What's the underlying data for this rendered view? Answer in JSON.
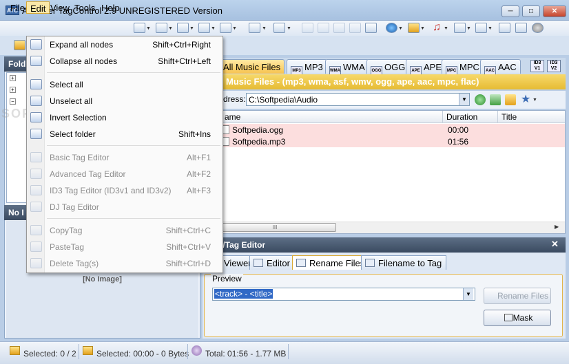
{
  "window": {
    "title": "Abander TagControl 2.9 UNREGISTERED Version",
    "icon_text": "ATC",
    "buttons": {
      "minimize": "─",
      "maximize": "□",
      "close": "✕"
    }
  },
  "menubar": {
    "items": [
      "File",
      "Edit",
      "View",
      "Tools",
      "Help"
    ],
    "active": "Edit"
  },
  "edit_menu": {
    "groups": [
      [
        {
          "label": "Expand all nodes",
          "shortcut": "Shift+Ctrl+Right",
          "enabled": true
        },
        {
          "label": "Collapse all nodes",
          "shortcut": "Shift+Ctrl+Left",
          "enabled": true
        }
      ],
      [
        {
          "label": "Select all",
          "shortcut": "",
          "enabled": true
        },
        {
          "label": "Unselect all",
          "shortcut": "",
          "enabled": true
        },
        {
          "label": "Invert Selection",
          "shortcut": "",
          "enabled": true
        },
        {
          "label": "Select folder",
          "shortcut": "Shift+Ins",
          "enabled": true
        }
      ],
      [
        {
          "label": "Basic Tag Editor",
          "shortcut": "Alt+F1",
          "enabled": false
        },
        {
          "label": "Advanced Tag Editor",
          "shortcut": "Alt+F2",
          "enabled": false
        },
        {
          "label": "ID3 Tag Editor (ID3v1 and ID3v2)",
          "shortcut": "Alt+F3",
          "enabled": false
        },
        {
          "label": "DJ Tag Editor",
          "shortcut": "",
          "enabled": false
        }
      ],
      [
        {
          "label": "CopyTag",
          "shortcut": "Shift+Ctrl+C",
          "enabled": false
        },
        {
          "label": "PasteTag",
          "shortcut": "Shift+Ctrl+V",
          "enabled": false
        },
        {
          "label": "Delete Tag(s)",
          "shortcut": "Shift+Ctrl+D",
          "enabled": false
        }
      ]
    ]
  },
  "left_panel": {
    "folders_head": "Fold",
    "no_image_head": "No I",
    "no_image_text": "[No Image]"
  },
  "tabs": [
    {
      "label": "All Music Files",
      "icon": "",
      "active": true
    },
    {
      "label": "MP3",
      "icon": "MP3",
      "active": false
    },
    {
      "label": "WMA",
      "icon": "WMA",
      "active": false
    },
    {
      "label": "OGG",
      "icon": "OGG",
      "active": false
    },
    {
      "label": "APE",
      "icon": "APE",
      "active": false
    },
    {
      "label": "MPC",
      "icon": "MPC",
      "active": false
    },
    {
      "label": "AAC",
      "icon": "AAC",
      "active": false
    }
  ],
  "id3_badges": [
    "ID3 V1",
    "ID3 V2"
  ],
  "banner": "Music Files - (mp3, wma, asf, wmv, ogg, ape, aac, mpc, flac)",
  "address": {
    "label": "dress:",
    "value": "C:\\Softpedia\\Audio"
  },
  "file_list": {
    "columns": [
      "ame",
      "Duration",
      "Title"
    ],
    "rows": [
      {
        "name": "Softpedia.ogg",
        "duration": "00:00",
        "title": ""
      },
      {
        "name": "Softpedia.mp3",
        "duration": "01:56",
        "title": ""
      }
    ],
    "scroll_thumb": "III"
  },
  "tag_editor": {
    "head": "er/Tag Editor",
    "close": "✕",
    "tabs": [
      "Viewer",
      "Editor",
      "Rename Files",
      "Filename to Tag"
    ],
    "active_tab": "Rename Files",
    "preview_label": "Preview",
    "preview_value": "<track> - <title>",
    "rename_button": "Rename Files",
    "mask_button": "Mask"
  },
  "statusbar": {
    "selected_count": "Selected: 0 / 2",
    "selected_size": "Selected: 00:00 - 0 Bytes",
    "total": "Total: 01:56 - 1.77 MB"
  },
  "watermark": "SOFTPEDIA"
}
